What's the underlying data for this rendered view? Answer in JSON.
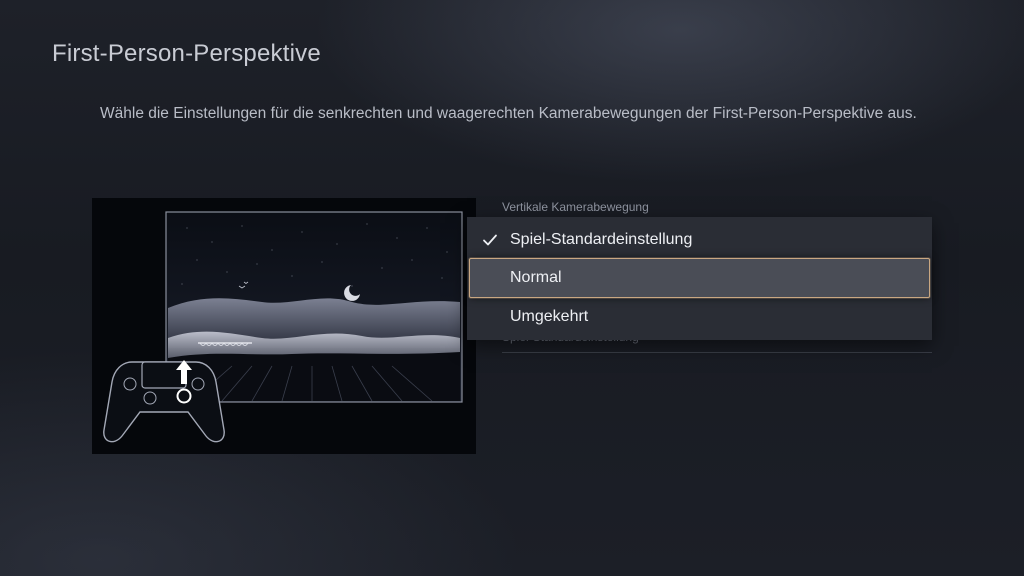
{
  "page": {
    "title": "First-Person-Perspektive",
    "description": "Wähle die Einstellungen für die senkrechten und waagerechten Kamerabewegungen der First-Person-Perspektive aus."
  },
  "setting": {
    "label": "Vertikale Kamerabewegung",
    "obscured_row_text": "Spiel-Standardeinstellung"
  },
  "dropdown": {
    "options": [
      {
        "label": "Spiel-Standardeinstellung",
        "selected": true,
        "focused": false
      },
      {
        "label": "Normal",
        "selected": false,
        "focused": true
      },
      {
        "label": "Umgekehrt",
        "selected": false,
        "focused": false
      }
    ]
  },
  "colors": {
    "background": "#1b1e25",
    "focus_border": "#c9a782",
    "menu_background": "#2a2d35",
    "focused_option_background": "#4a4d56"
  },
  "icons": {
    "selected_marker": "checkmark-icon",
    "preview_controller": "dualsense-controller-icon",
    "preview_arrow": "arrow-up-icon"
  }
}
